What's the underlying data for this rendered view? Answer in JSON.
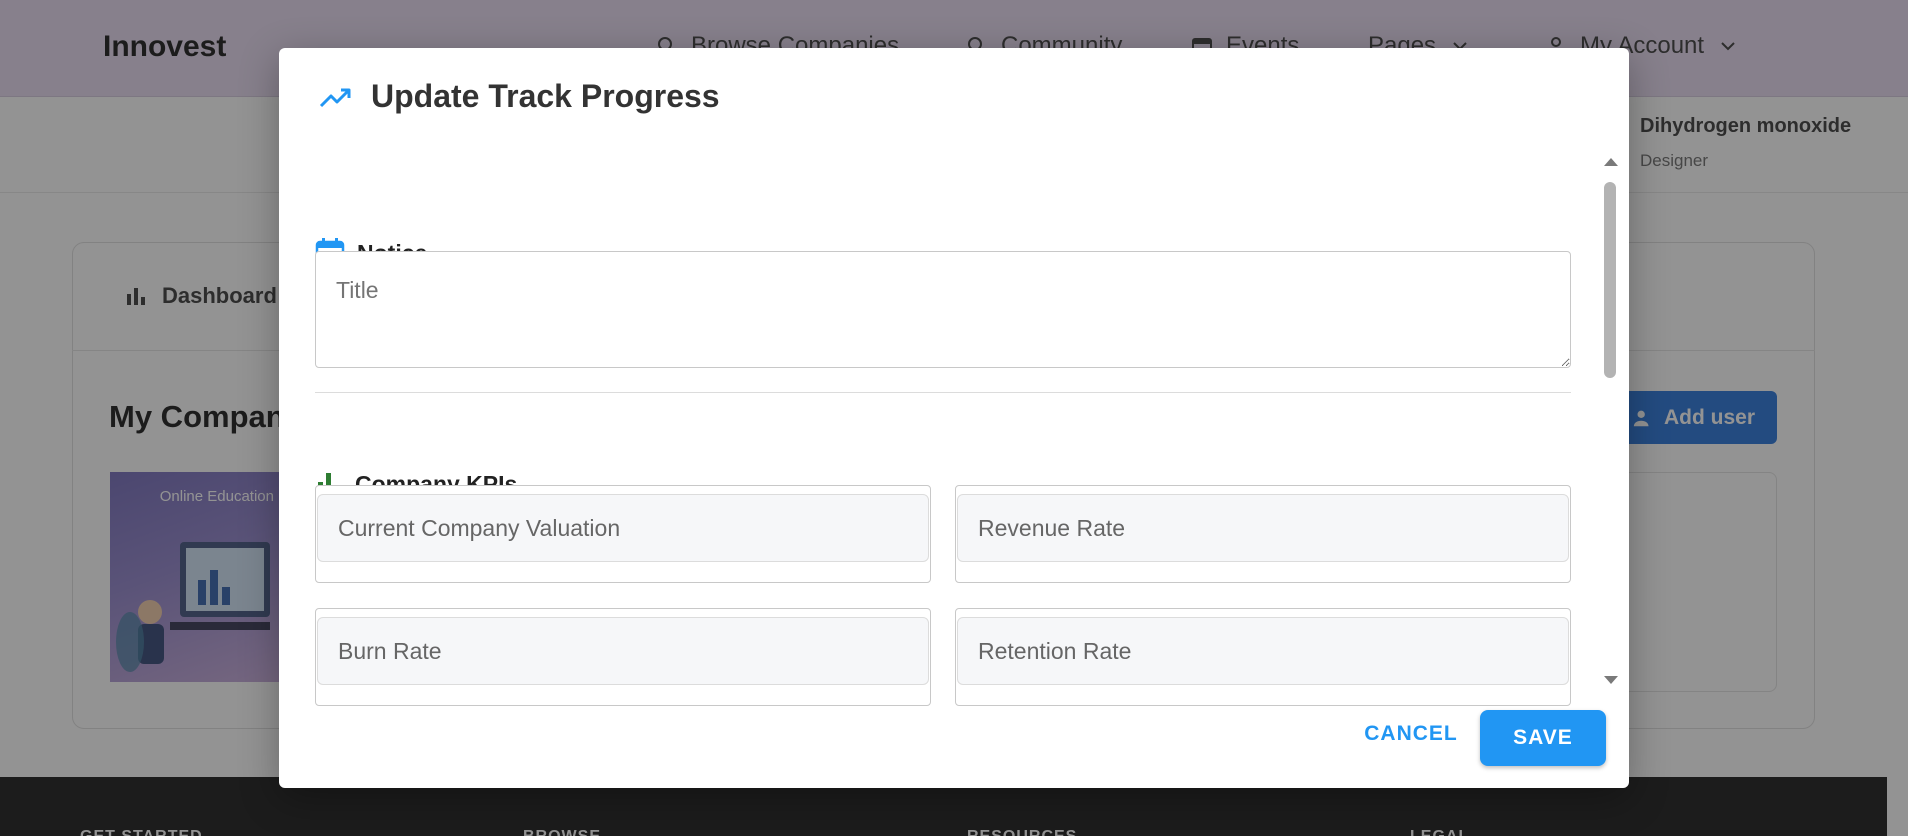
{
  "app": {
    "brand": "Innovest",
    "nav": {
      "browse": "Browse Companies",
      "community": "Community",
      "events": "Events",
      "pages": "Pages",
      "account": "My Account"
    },
    "user": {
      "name": "Dihydrogen monoxide",
      "role": "Designer"
    },
    "tabs": {
      "dashboard": "Dashboard"
    },
    "section_title": "My Companies",
    "add_user": "Add user",
    "company_image_text": "Online Education",
    "footer": [
      "GET STARTED",
      "BROWSE",
      "RESOURCES",
      "LEGAL"
    ]
  },
  "dialog": {
    "title": "Update Track Progress",
    "notice": {
      "heading": "Notice",
      "title_placeholder": "Title"
    },
    "kpis": {
      "heading": "Company KPIs",
      "fields": [
        {
          "label": "Current Company Valuation"
        },
        {
          "label": "Revenue Rate"
        },
        {
          "label": "Burn Rate"
        },
        {
          "label": "Retention Rate"
        }
      ]
    },
    "buttons": {
      "cancel": "CANCEL",
      "save": "SAVE"
    }
  },
  "colors": {
    "accent": "#2196f3",
    "kpi_icon": "#2e7d32",
    "nav_bg": "#e6d9f0",
    "add_user_bg": "#1e6fd9"
  }
}
